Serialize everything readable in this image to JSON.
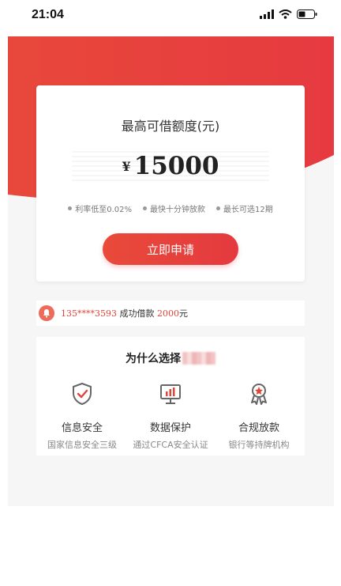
{
  "status_bar": {
    "time": "21:04"
  },
  "hero": {
    "title": "最高可借额度(元)",
    "currency": "¥",
    "amount": "15000",
    "features": [
      "利率低至0.02%",
      "最快十分钟放款",
      "最长可选12期"
    ],
    "apply_button": "立即申请"
  },
  "notice": {
    "phone": "135****3593",
    "text": "成功借款",
    "amount": "2000",
    "unit": "元"
  },
  "why": {
    "title": "为什么选择",
    "items": [
      {
        "icon": "shield-check-icon",
        "label": "信息安全",
        "desc": "国家信息安全三级"
      },
      {
        "icon": "monitor-chart-icon",
        "label": "数据保护",
        "desc": "通过CFCA安全认证"
      },
      {
        "icon": "award-medal-icon",
        "label": "合规放款",
        "desc": "银行等持牌机构"
      }
    ]
  },
  "colors": {
    "accent": "#e43a3f",
    "hero_red": "#e8483b",
    "notice_icon": "#ed6b5a"
  }
}
